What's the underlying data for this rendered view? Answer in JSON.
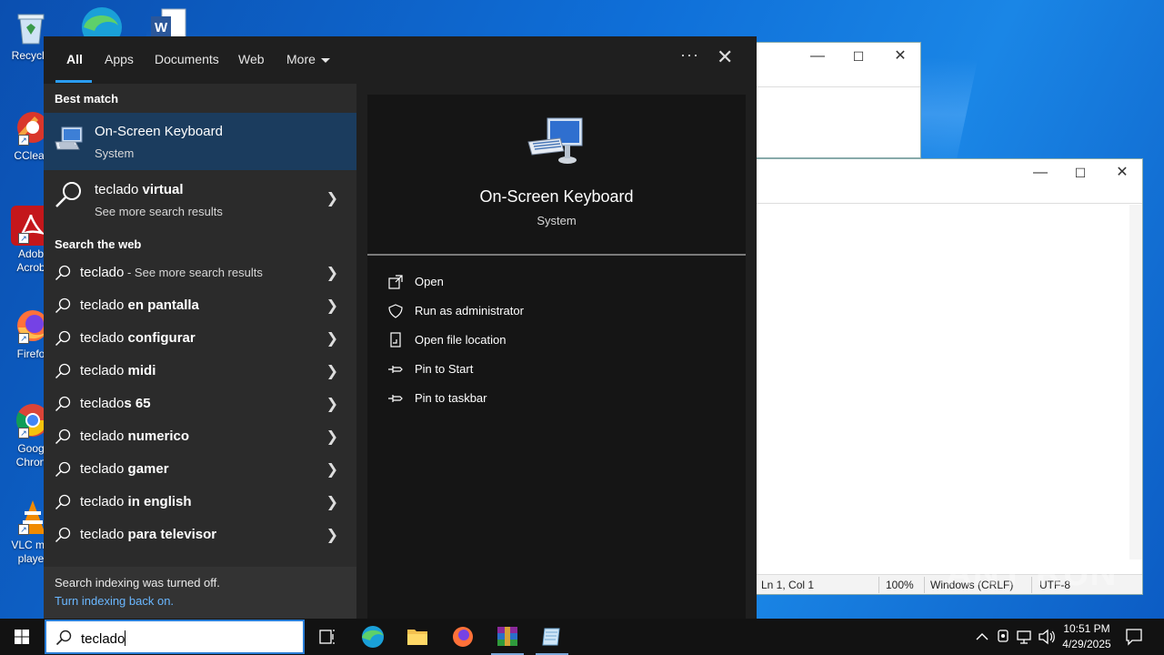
{
  "desktop": {
    "icons": [
      {
        "label": "Recycle",
        "icon": "recycle-bin-icon"
      },
      {
        "label": "CClear",
        "icon": "ccleaner-icon"
      },
      {
        "label": "Adob\nAcrob",
        "icon": "adobe-acrobat-icon"
      },
      {
        "label": "Firefo",
        "icon": "firefox-icon"
      },
      {
        "label": "Goog\nChron",
        "icon": "chrome-icon"
      },
      {
        "label": "VLC me\nplaye",
        "icon": "vlc-icon"
      }
    ]
  },
  "bg_window": {
    "statusbar": {
      "position": "Ln 1, Col 1",
      "zoom": "100%",
      "eol": "Windows (CRLF)",
      "encoding": "UTF-8"
    }
  },
  "search": {
    "tabs": [
      {
        "label": "All",
        "active": true
      },
      {
        "label": "Apps"
      },
      {
        "label": "Documents"
      },
      {
        "label": "Web"
      },
      {
        "label": "More"
      }
    ],
    "best_match_heading": "Best match",
    "best_match": {
      "title": "On-Screen Keyboard",
      "subtitle": "System"
    },
    "virtual": {
      "prefix": "teclado ",
      "bold": "virtual",
      "subtitle": "See more search results"
    },
    "web_heading": "Search the web",
    "web_results": [
      {
        "prefix": "teclado",
        "bold": "",
        "extra": " - See more search results"
      },
      {
        "prefix": "teclado ",
        "bold": "en pantalla",
        "extra": ""
      },
      {
        "prefix": "teclado ",
        "bold": "configurar",
        "extra": ""
      },
      {
        "prefix": "teclado ",
        "bold": "midi",
        "extra": ""
      },
      {
        "prefix": "teclado",
        "bold": "s 65",
        "extra": ""
      },
      {
        "prefix": "teclado ",
        "bold": "numerico",
        "extra": ""
      },
      {
        "prefix": "teclado ",
        "bold": "gamer",
        "extra": ""
      },
      {
        "prefix": "teclado ",
        "bold": "in english",
        "extra": ""
      },
      {
        "prefix": "teclado ",
        "bold": "para televisor",
        "extra": ""
      }
    ],
    "footer": {
      "line1": "Search indexing was turned off.",
      "link": "Turn indexing back on."
    },
    "detail": {
      "title": "On-Screen Keyboard",
      "subtitle": "System",
      "actions": [
        {
          "label": "Open",
          "icon": "open-icon"
        },
        {
          "label": "Run as administrator",
          "icon": "shield-icon"
        },
        {
          "label": "Open file location",
          "icon": "file-location-icon"
        },
        {
          "label": "Pin to Start",
          "icon": "pin-icon"
        },
        {
          "label": "Pin to taskbar",
          "icon": "pin-icon"
        }
      ]
    },
    "query": "teclado"
  },
  "taskbar": {
    "clock_time": "10:51 PM",
    "clock_date": "4/29/2025"
  },
  "watermark": "ANY RUN"
}
